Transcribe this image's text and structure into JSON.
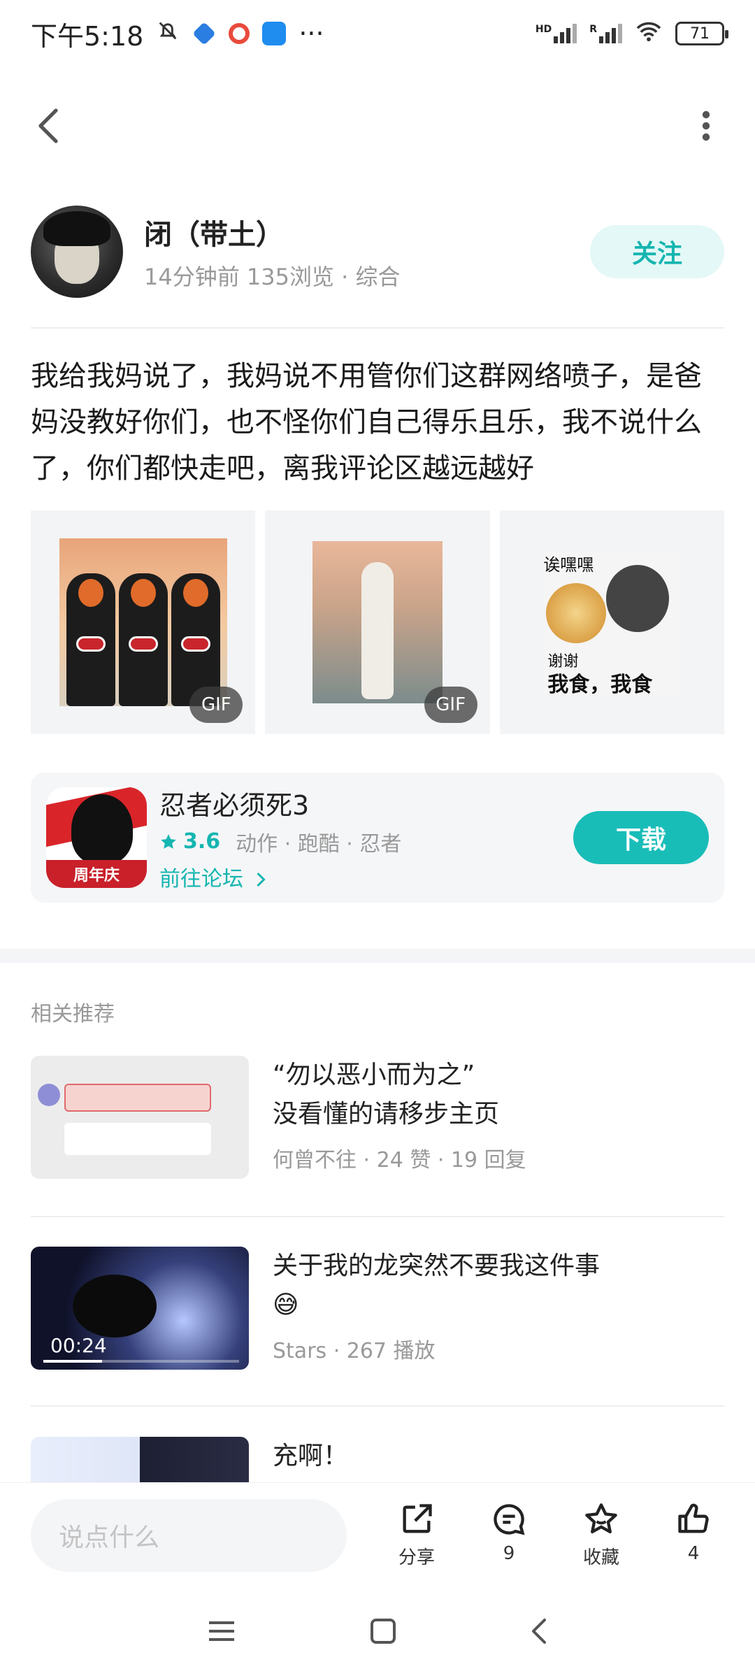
{
  "status_bar": {
    "time": "下午5:18",
    "more": "···",
    "hd": "HD",
    "roaming": "R",
    "battery": "71"
  },
  "author": {
    "name": "闭（带土）",
    "meta": "14分钟前  135浏览  ·  综合",
    "follow_label": "关注"
  },
  "post": {
    "text": "我给我妈说了，我妈说不用管你们这群网络喷子，是爸妈没教好你们，也不怪你们自己得乐且乐，我不说什么了，你们都快走吧，离我评论区越远越好",
    "images": [
      {
        "badge": "GIF"
      },
      {
        "badge": "GIF"
      },
      {
        "caption_top": "诶嘿嘿",
        "caption_small": "谢谢",
        "caption_big": "我食，我食"
      }
    ]
  },
  "game": {
    "title": "忍者必须死3",
    "icon_tag": "周年庆",
    "rating": "3.6",
    "tags": "动作 · 跑酷 · 忍者",
    "forum_link": "前往论坛",
    "download_label": "下载"
  },
  "related": {
    "title": "相关推荐",
    "items": [
      {
        "title_line1": "“勿以恶小而为之”",
        "title_line2": "没看懂的请移步主页",
        "meta": "何曾不往  ·  24 赞  ·  19 回复"
      },
      {
        "title_line1": "关于我的龙突然不要我这件事",
        "title_line2": "😅",
        "meta": "Stars  ·  267 播放",
        "duration": "00:24",
        "progress": 0.3
      },
      {
        "title_line1": "充啊！"
      }
    ]
  },
  "action_bar": {
    "comment_placeholder": "说点什么",
    "share_label": "分享",
    "comment_count": "9",
    "favorite_label": "收藏",
    "like_count": "4"
  },
  "colors": {
    "accent": "#19bdb8",
    "follow_bg": "#e3f8f7"
  }
}
